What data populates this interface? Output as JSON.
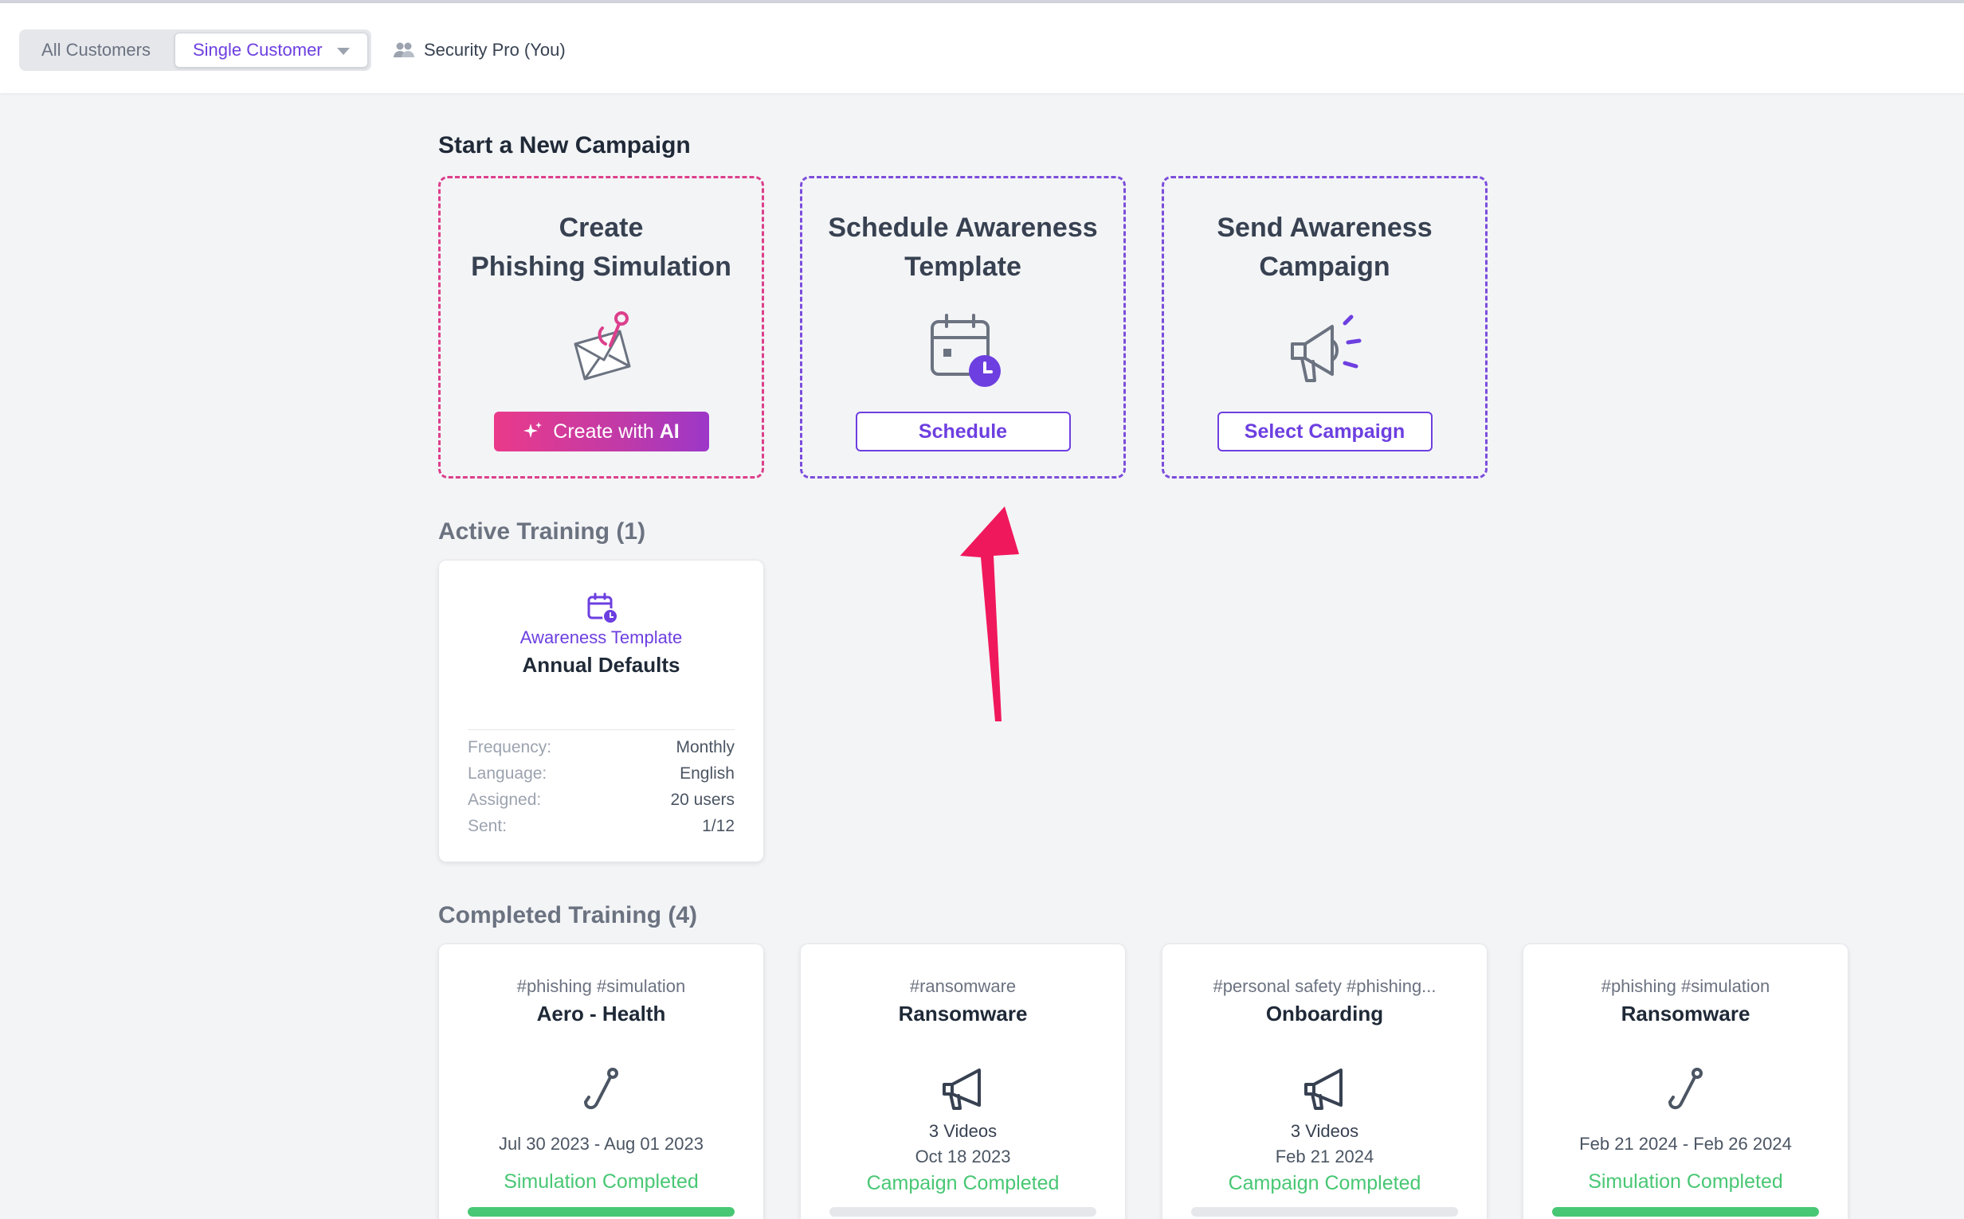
{
  "header": {
    "scope_tabs": [
      {
        "label": "All Customers",
        "selected": false
      },
      {
        "label": "Single Customer",
        "selected": true
      }
    ],
    "user": "Security Pro (You)"
  },
  "new_campaign": {
    "title": "Start a New Campaign",
    "cards": [
      {
        "title_line1": "Create",
        "title_line2": "Phishing Simulation",
        "button_prefix": "Create with ",
        "button_emph": "AI",
        "icon": "phishing-envelope-icon"
      },
      {
        "title_line1": "Schedule Awareness",
        "title_line2": "Template",
        "button": "Schedule",
        "icon": "calendar-clock-icon"
      },
      {
        "title_line1": "Send Awareness",
        "title_line2": "Campaign",
        "button": "Select Campaign",
        "icon": "megaphone-icon"
      }
    ]
  },
  "active_training": {
    "title": "Active Training (1)",
    "card": {
      "type": "Awareness Template",
      "name": "Annual Defaults",
      "rows": [
        {
          "label": "Frequency:",
          "value": "Monthly"
        },
        {
          "label": "Language:",
          "value": "English"
        },
        {
          "label": "Assigned:",
          "value": "20 users"
        },
        {
          "label": "Sent:",
          "value": "1/12"
        }
      ]
    }
  },
  "completed_training": {
    "title": "Completed Training (4)",
    "cards": [
      {
        "tags": "#phishing #simulation",
        "name": "Aero - Health",
        "icon": "fishhook-icon",
        "date": "Jul 30 2023 - Aug 01 2023",
        "status": "Simulation Completed",
        "progress": 1.0
      },
      {
        "tags": "#ransomware",
        "name": "Ransomware",
        "icon": "megaphone-icon",
        "videos": "3 Videos",
        "date": "Oct 18 2023",
        "status": "Campaign Completed",
        "progress": 0.0
      },
      {
        "tags": "#personal safety #phishing...",
        "name": "Onboarding",
        "icon": "megaphone-icon",
        "videos": "3 Videos",
        "date": "Feb 21 2024",
        "status": "Campaign Completed",
        "progress": 0.0
      },
      {
        "tags": "#phishing #simulation",
        "name": "Ransomware",
        "icon": "fishhook-icon",
        "date": "Feb 21 2024 - Feb 26 2024",
        "status": "Simulation Completed",
        "progress": 1.0
      }
    ]
  },
  "colors": {
    "accent": "#6d3fe0",
    "pink": "#dc3f8c",
    "success": "#48c774",
    "annotation_arrow": "#f0185c"
  }
}
